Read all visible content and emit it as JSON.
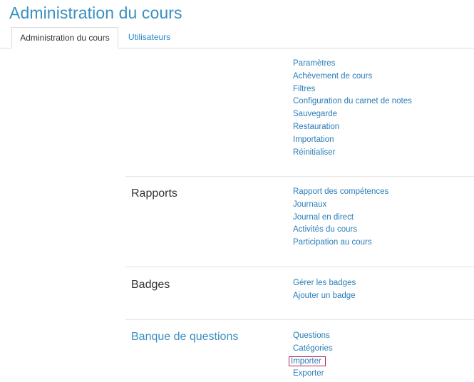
{
  "page": {
    "title": "Administration du cours"
  },
  "tabs": [
    {
      "label": "Administration du cours",
      "active": true
    },
    {
      "label": "Utilisateurs",
      "active": false
    }
  ],
  "sections": {
    "course": {
      "links": [
        "Paramètres",
        "Achèvement de cours",
        "Filtres",
        "Configuration du carnet de notes",
        "Sauvegarde",
        "Restauration",
        "Importation",
        "Réinitialiser"
      ]
    },
    "reports": {
      "title": "Rapports",
      "links": [
        "Rapport des compétences",
        "Journaux",
        "Journal en direct",
        "Activités du cours",
        "Participation au cours"
      ]
    },
    "badges": {
      "title": "Badges",
      "links": [
        "Gérer les badges",
        "Ajouter un badge"
      ]
    },
    "questionbank": {
      "title": "Banque de questions",
      "links": [
        "Questions",
        "Catégories",
        "Importer",
        "Exporter"
      ],
      "highlighted": "Importer"
    }
  },
  "colors": {
    "title": "#3a8fc1",
    "link": "#2a7db7",
    "highlight": "#b3265a"
  }
}
